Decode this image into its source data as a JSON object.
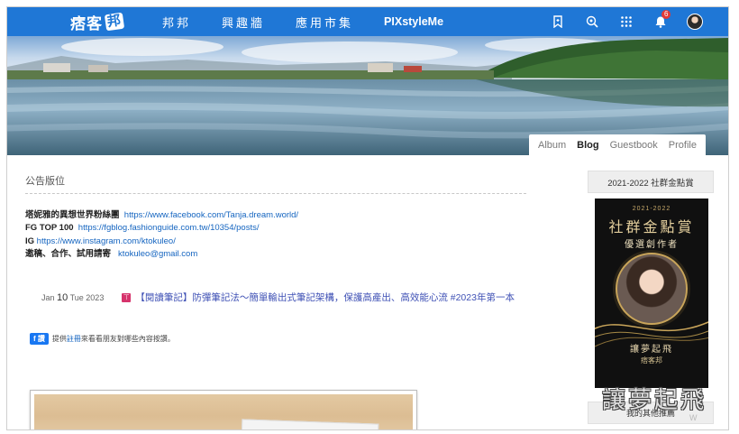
{
  "topbar": {
    "logo": "痞客",
    "logo_badge": "邦",
    "nav": [
      "邦邦",
      "興趣牆",
      "應用市集",
      "PIXstyleMe"
    ],
    "icons": [
      "bookmark-icon",
      "explore-icon",
      "apps-grid-icon",
      "bell-icon",
      "avatar"
    ],
    "notification_count": "6",
    "accent_color": "#1f77d6"
  },
  "blog_tabs": [
    "Album",
    "Blog",
    "Guestbook",
    "Profile"
  ],
  "active_tab": "Blog",
  "notice": {
    "title": "公告版位",
    "lines": [
      {
        "label": "塔妮雅的異想世界粉絲團",
        "link": "https://www.facebook.com/Tanja.dream.world/"
      },
      {
        "label": "FG TOP 100",
        "link": "https://fgblog.fashionguide.com.tw/10354/posts/"
      },
      {
        "label": "IG",
        "link": "https://www.instagram.com/ktokuleo/"
      },
      {
        "label": "邀稿、合作、試用請寄",
        "link": "ktokuleo@gmail.com"
      }
    ]
  },
  "post": {
    "date_month": "Jan",
    "date_day": "10",
    "date_rest": "Tue 2023",
    "pin_icon": "pin-icon",
    "title": "【閱讀筆記】防彈筆記法～簡單輸出式筆記架構，保護高產出、高效能心流 #2023年第一本"
  },
  "fb": {
    "like_label": "讚",
    "text_before": "提供",
    "link": "註冊",
    "text_after": "來看看朋友對哪些內容按讚。"
  },
  "sidebar": {
    "title": "2021-2022 社群金點賞",
    "award": {
      "year": "2021-2022",
      "title": "社群金點賞",
      "subtitle": "優選創作者",
      "name": "讓夢起飛",
      "site": "痞客邦"
    },
    "button": "我的其他推薦"
  },
  "watermark": {
    "text": "讓夢起飛",
    "sub": "W"
  }
}
